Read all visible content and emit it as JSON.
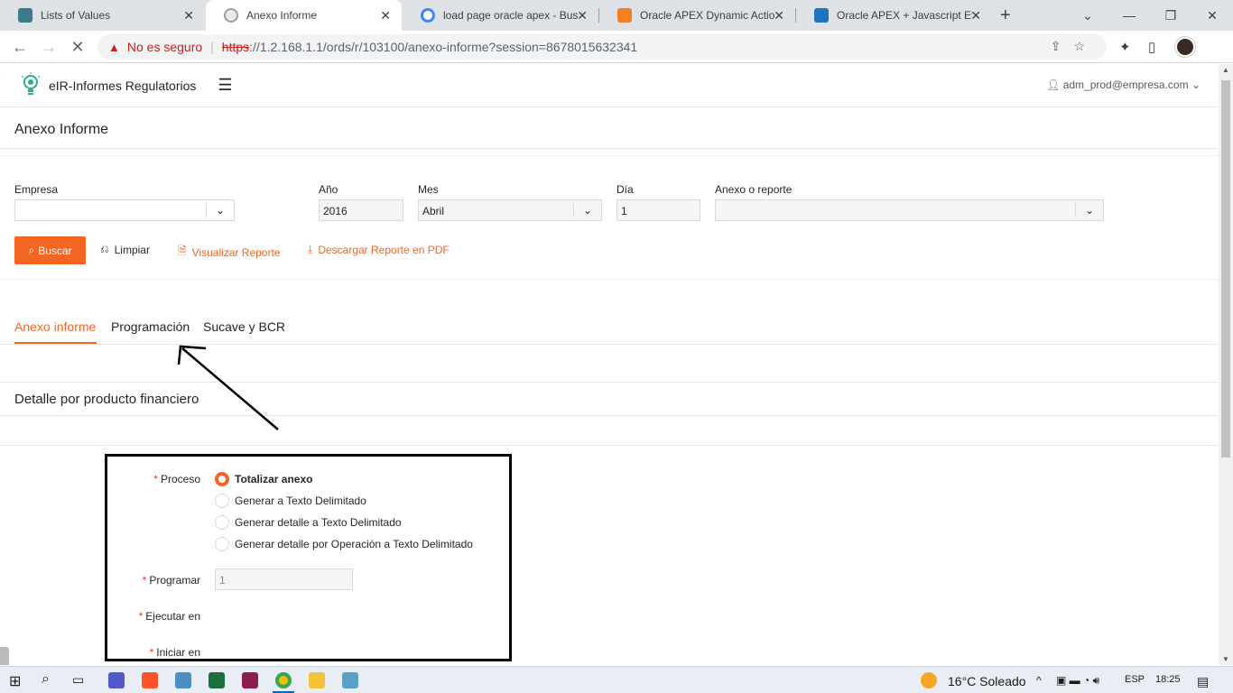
{
  "browser": {
    "tabs": [
      {
        "title": "Lists of Values",
        "favicon": "apex-icon",
        "color": "#3a7a8c"
      },
      {
        "title": "Anexo Informe",
        "favicon": "loading-icon",
        "color": "#9aa0a6"
      },
      {
        "title": "load page oracle apex - Busc",
        "favicon": "google-icon",
        "color": "#4285f4"
      },
      {
        "title": "Oracle APEX Dynamic Action",
        "favicon": "stackoverflow-icon",
        "color": "#f48024"
      },
      {
        "title": "Oracle APEX + Javascript Eve",
        "favicon": "apex-blue-icon",
        "color": "#1e73be"
      }
    ],
    "security_label": "No es seguro",
    "url_https": "https",
    "url_rest": "://1.2.168.1.1/ords/r/103100/anexo-informe?session=8678015632341"
  },
  "app": {
    "name": "eIR-Informes Regulatorios",
    "user": "adm_prod@empresa.com",
    "page_title": "Anexo Informe",
    "filters": {
      "empresa_label": "Empresa",
      "empresa_value": "",
      "anio_label": "Año",
      "anio_value": "2016",
      "mes_label": "Mes",
      "mes_value": "Abril",
      "dia_label": "Día",
      "dia_value": "1",
      "anexo_label": "Anexo o reporte",
      "anexo_value": ""
    },
    "actions": {
      "buscar": "Buscar",
      "limpiar": "Limpiar",
      "visualizar": "Visualizar Reporte",
      "descargar": "Descargar Reporte en PDF"
    },
    "tabs": [
      "Anexo informe",
      "Programación",
      "Sucave y BCR"
    ],
    "subtitle": "Detalle por producto financiero",
    "form": {
      "proceso_label": "Proceso",
      "options": [
        "Totalizar anexo",
        "Generar a Texto Delimitado",
        "Generar detalle a Texto Delimitado",
        "Generar detalle por Operación a Texto Delimitado"
      ],
      "selected_index": 0,
      "programar_label": "Programar",
      "programar_value": "1",
      "ejecutar_label": "Ejecutar en",
      "iniciar_label": "Iniciar en",
      "required_mark": "*"
    }
  },
  "taskbar": {
    "weather": "16°C  Soleado",
    "lang": "ESP",
    "time": "18:25"
  }
}
